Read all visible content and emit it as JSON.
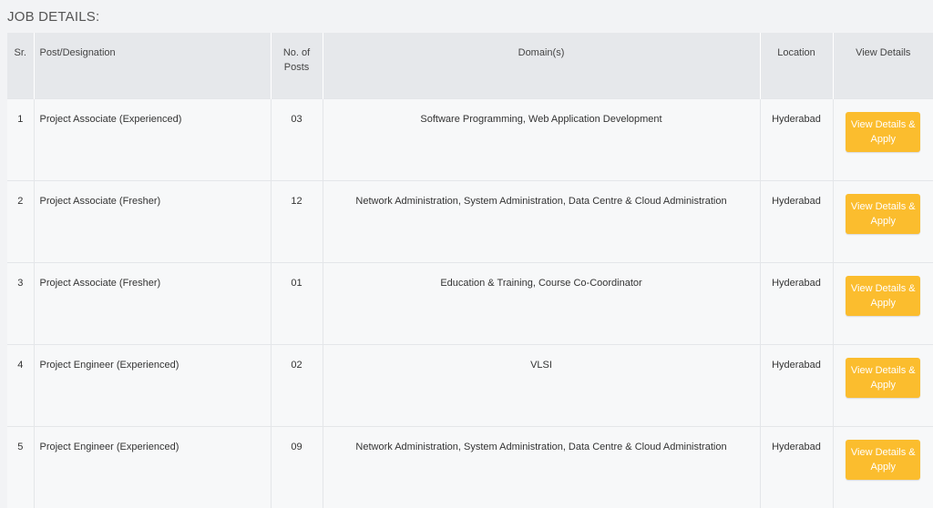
{
  "heading": "JOB DETAILS:",
  "table": {
    "headers": {
      "sr": "Sr.",
      "post": "Post/Designation",
      "num": "No. of Posts",
      "domain": "Domain(s)",
      "location": "Location",
      "view": "View Details"
    },
    "rows": [
      {
        "sr": "1",
        "post": "Project Associate (Experienced)",
        "num": "03",
        "domain": "Software Programming, Web Application Development",
        "location": "Hyderabad",
        "button": "View Details & Apply"
      },
      {
        "sr": "2",
        "post": "Project Associate (Fresher)",
        "num": "12",
        "domain": "Network Administration, System Administration, Data Centre & Cloud Administration",
        "location": "Hyderabad",
        "button": "View Details & Apply"
      },
      {
        "sr": "3",
        "post": "Project Associate (Fresher)",
        "num": "01",
        "domain": "Education & Training, Course Co-Coordinator",
        "location": "Hyderabad",
        "button": "View Details & Apply"
      },
      {
        "sr": "4",
        "post": "Project Engineer (Experienced)",
        "num": "02",
        "domain": "VLSI",
        "location": "Hyderabad",
        "button": "View Details & Apply"
      },
      {
        "sr": "5",
        "post": "Project Engineer (Experienced)",
        "num": "09",
        "domain": "Network Administration, System Administration, Data Centre & Cloud Administration",
        "location": "Hyderabad",
        "button": "View Details & Apply"
      }
    ]
  },
  "colors": {
    "button": "#fbbd2e",
    "header_bg": "#e6e8eb",
    "row_bg": "#f7f8f9"
  }
}
